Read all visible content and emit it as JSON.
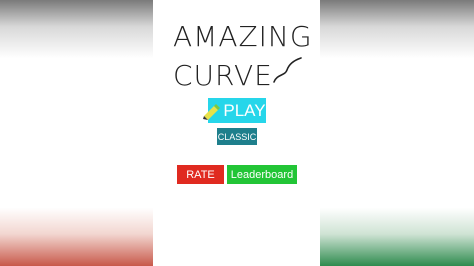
{
  "game": {
    "title_line1": "AMAZING",
    "title_line2": "CURVE"
  },
  "menu": {
    "play_label": "PLAY",
    "classic_label": "CLASSIC",
    "rate_label": "RATE",
    "leaderboard_label": "Leaderboard"
  },
  "icons": {
    "curve": "curve-icon",
    "play": "pencil-icon"
  },
  "colors": {
    "play_button": "#26d6ea",
    "classic_button": "#1e7f8c",
    "rate_button": "#e02a20",
    "leaderboard_button": "#22c536",
    "background": "#ffffff"
  }
}
